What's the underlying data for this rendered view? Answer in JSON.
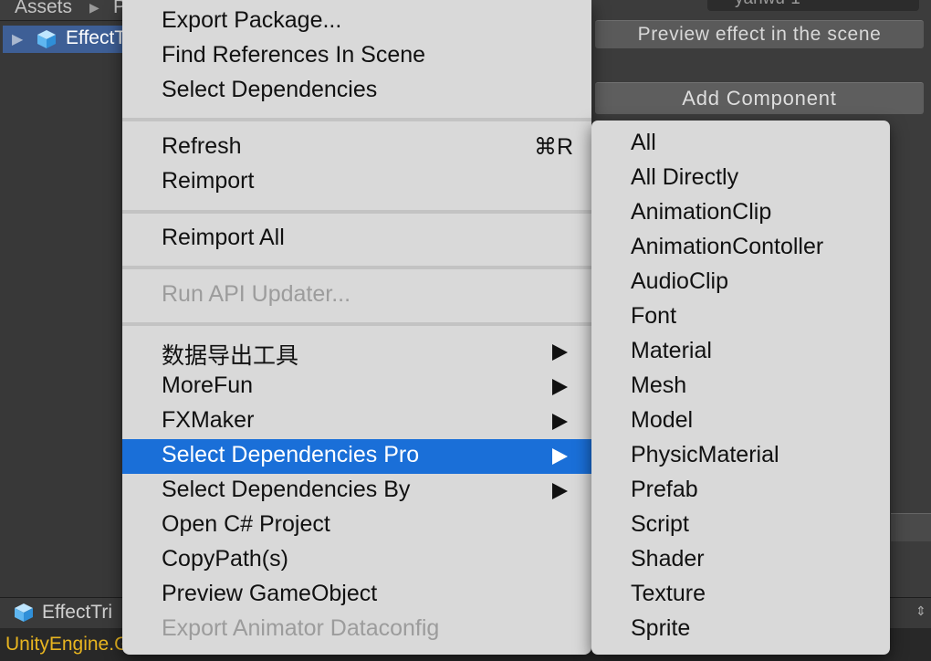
{
  "project_panel": {
    "breadcrumb_root": "Assets",
    "breadcrumb_next": "P",
    "selected_item": "EffectT",
    "bottom_item": "EffectTri"
  },
  "inspector": {
    "top_field_label": "yanwu-1",
    "preview_button": "Preview effect in the scene",
    "add_component_button": "Add Component"
  },
  "console": {
    "message": "UnityEngine.GameObject:set_hideFlags - true"
  },
  "context_menu": {
    "items": [
      {
        "label": "Export Package...",
        "disabled": false
      },
      {
        "label": "Find References In Scene",
        "disabled": false
      },
      {
        "label": "Select Dependencies",
        "disabled": false
      },
      {
        "label": "Refresh",
        "shortcut": "⌘R",
        "disabled": false
      },
      {
        "label": "Reimport",
        "disabled": false
      },
      {
        "label": "Reimport All",
        "disabled": false
      },
      {
        "label": "Run API Updater...",
        "disabled": true
      },
      {
        "label": "数据导出工具",
        "submenu": true
      },
      {
        "label": "MoreFun",
        "submenu": true
      },
      {
        "label": "FXMaker",
        "submenu": true
      },
      {
        "label": "Select Dependencies Pro",
        "submenu": true,
        "highlighted": true
      },
      {
        "label": "Select Dependencies By",
        "submenu": true
      },
      {
        "label": "Open C# Project",
        "disabled": false
      },
      {
        "label": "CopyPath(s)",
        "disabled": false
      },
      {
        "label": "Preview GameObject",
        "disabled": false
      },
      {
        "label": "Export Animator Dataconfig",
        "disabled": true
      }
    ]
  },
  "submenu": {
    "items": [
      "All",
      "All Directly",
      "AnimationClip",
      "AnimationContoller",
      "AudioClip",
      "Font",
      "Material",
      "Mesh",
      "Model",
      "PhysicMaterial",
      "Prefab",
      "Script",
      "Shader",
      "Texture",
      "Sprite"
    ]
  },
  "colors": {
    "highlight": "#1a6fd8",
    "menu_bg": "#d9d9d9",
    "selection_row": "#3e5f96",
    "console_warning": "#e8b520"
  }
}
